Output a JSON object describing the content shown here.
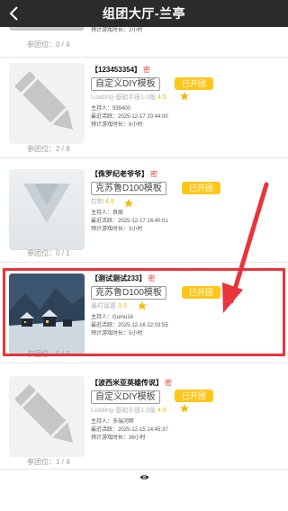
{
  "header": {
    "title": "组团大厅-兰亭"
  },
  "top_partial": {
    "duration_label": "预计游戏时长：2小时",
    "seat_label": "参团位：0 / 4"
  },
  "cards": [
    {
      "name": "【123453354】",
      "lock": "密",
      "template": "自定义DIY模板",
      "subtitle": "Loading-基础手册1.0版",
      "score": "4.5",
      "status": "已开团",
      "host": "主持人：939400",
      "last_active": "最近活跃：2025-12-17 20:44:00",
      "duration": "预计游戏时长：8小时",
      "seat": "参团位：2 / 8"
    },
    {
      "name": "【侏罗纪老爷爷】",
      "lock": "密",
      "template": "克苏鲁D100模板",
      "subtitle": "控制",
      "score": "4.9",
      "status": "已开团",
      "host": "主持人：良辰",
      "last_active": "最近活跃：2025-12-17 16:40:01",
      "duration": "预计游戏时长：3小时",
      "seat": "参团位：0 / 1"
    },
    {
      "name": "【测试测试233】",
      "lock": "密",
      "template": "克苏鲁D100模板",
      "subtitle": "暴村留置",
      "score": "3.3",
      "status": "已开团",
      "host": "主持人：Gumu14",
      "last_active": "最近活跃：2025-12-16 22:03:55",
      "duration": "预计游戏时长：5小时",
      "seat": "参团位：0 / 3"
    },
    {
      "name": "【波西米亚英雄传说】",
      "lock": "密",
      "template": "自定义DIY模板",
      "subtitle": "Loading-基础手册1.0版",
      "score": "4.9",
      "status": "已开团",
      "host": "主持人：多瑞河畔",
      "last_active": "最近活跃：2025-12-15 14:45:37",
      "duration": "预计游戏时长：36小时",
      "seat": "参团位：1 / 4"
    }
  ],
  "icons": {
    "back": "chevron-left-icon",
    "star": "star-icon",
    "pencil": "pencil-icon",
    "eye": "eye-icon"
  },
  "colors": {
    "header_bg": "#2b2b2b",
    "status_bg": "#ffc61a",
    "lock": "#e03a2f",
    "annotation": "#e8343a"
  }
}
